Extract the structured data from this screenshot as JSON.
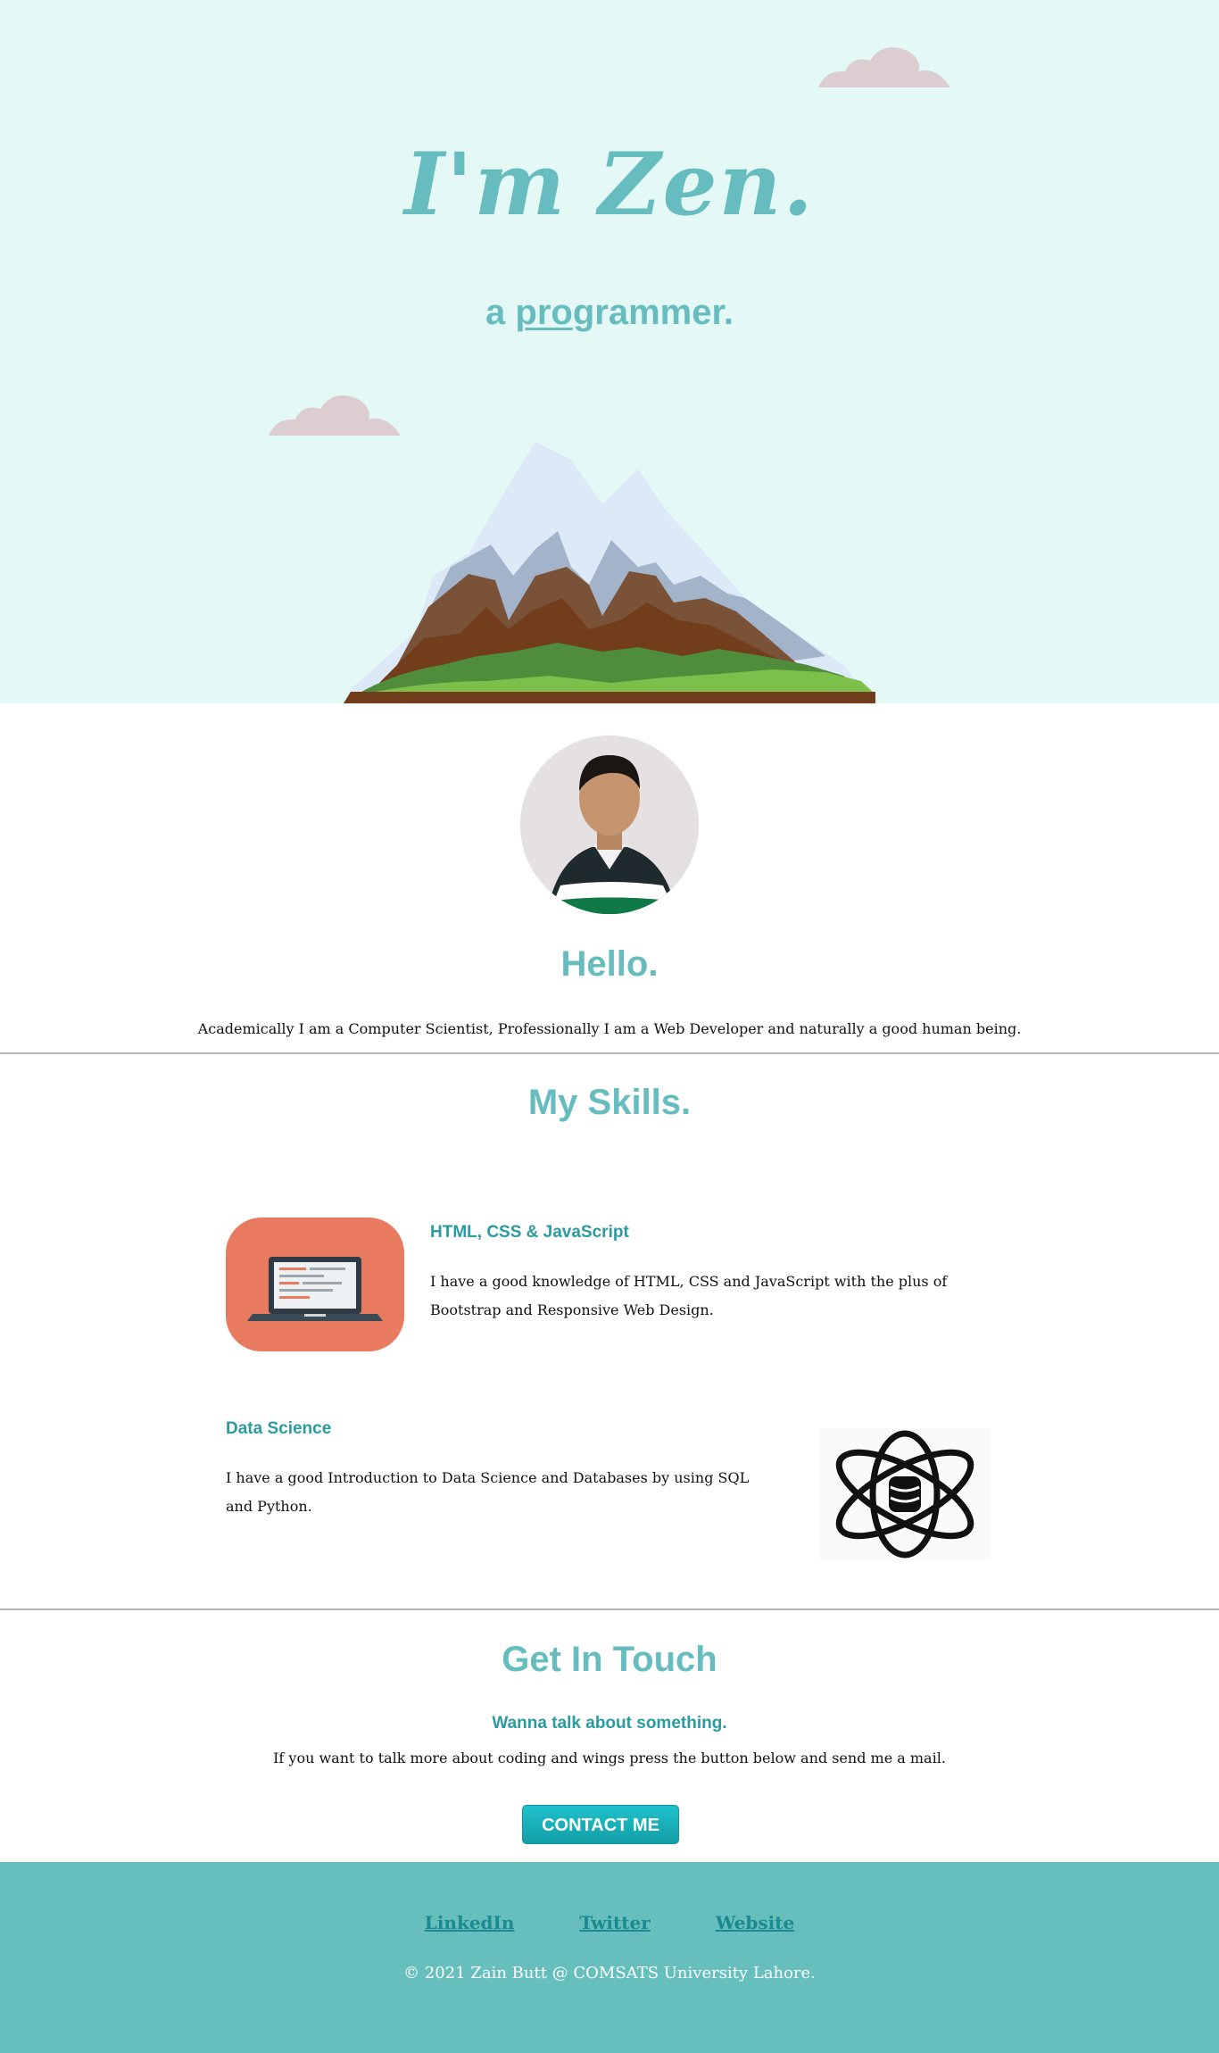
{
  "hero": {
    "title": "I'm Zen.",
    "subtitle_prefix": "a ",
    "subtitle_underlined": "pro",
    "subtitle_rest": "grammer."
  },
  "profile": {
    "greeting": "Hello.",
    "intro": "Academically I am a Computer Scientist, Professionally I am a Web Developer and naturally a good human being."
  },
  "skills": {
    "title": "My Skills.",
    "items": [
      {
        "heading": "HTML, CSS & JavaScript",
        "text": "I have a good knowledge of HTML, CSS and JavaScript with the plus of Bootstrap and Responsive Web Design.",
        "icon": "laptop-icon"
      },
      {
        "heading": "Data Science",
        "text": "I have a good Introduction to Data Science and Databases by using SQL and Python.",
        "icon": "database-atom-icon"
      }
    ]
  },
  "contact": {
    "title": "Get In Touch",
    "subtitle": "Wanna talk about something.",
    "text": "If you want to talk more about coding and wings press the button below and send me a mail.",
    "button": "CONTACT ME"
  },
  "footer": {
    "links": [
      "LinkedIn",
      "Twitter",
      "Website"
    ],
    "copyright": "© 2021 Zain Butt @ COMSATS University Lahore."
  },
  "colors": {
    "hero_bg": "#e4f9f5",
    "accent": "#66bcbe",
    "footer_bg": "#66bfbd",
    "button": "#1ec2cc",
    "skill_icon_bg": "#e77a5f"
  }
}
